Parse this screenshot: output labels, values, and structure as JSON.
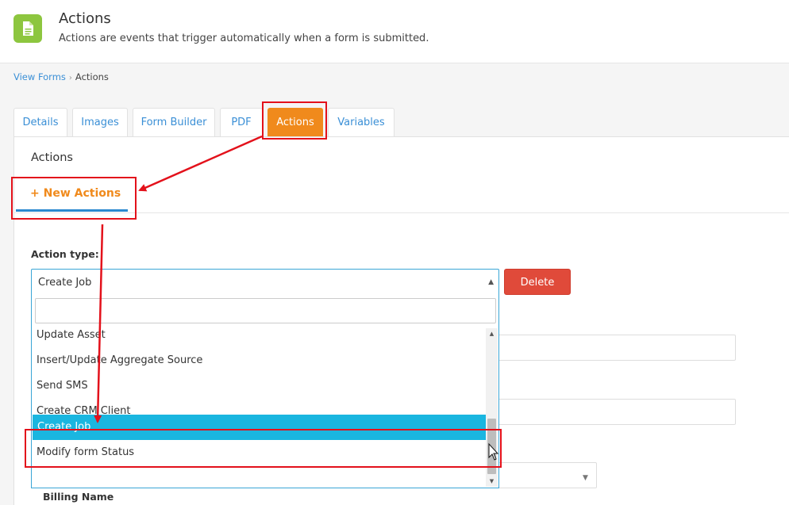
{
  "header": {
    "title": "Actions",
    "subtitle": "Actions are events that trigger automatically when a form is submitted.",
    "icon": "document-icon",
    "icon_color": "#8dc63f"
  },
  "breadcrumb": {
    "link": "View Forms",
    "separator": "›",
    "current": "Actions"
  },
  "tabs": [
    {
      "label": "Details"
    },
    {
      "label": "Images"
    },
    {
      "label": "Form Builder"
    },
    {
      "label": "PDF"
    },
    {
      "label": "Actions",
      "active": true
    },
    {
      "label": "Variables"
    }
  ],
  "panel": {
    "title": "Actions",
    "new_actions_plus": "+",
    "new_actions_label": "New Actions"
  },
  "form": {
    "action_type_label": "Action type:",
    "selected_value": "Create Job",
    "delete_label": "Delete",
    "billing_label": "Billing Name"
  },
  "dropdown": {
    "search_value": "",
    "options": [
      "Update Asset",
      "Insert/Update Aggregate Source",
      "Send SMS",
      "Create CRM Client",
      "Create Job",
      "Modify form Status"
    ],
    "highlighted": "Create Job"
  },
  "colors": {
    "accent": "#f08a1c",
    "link": "#3a8fd6",
    "danger": "#e04a3a",
    "highlight": "#1ab6e0",
    "annotation": "#e3111b"
  }
}
